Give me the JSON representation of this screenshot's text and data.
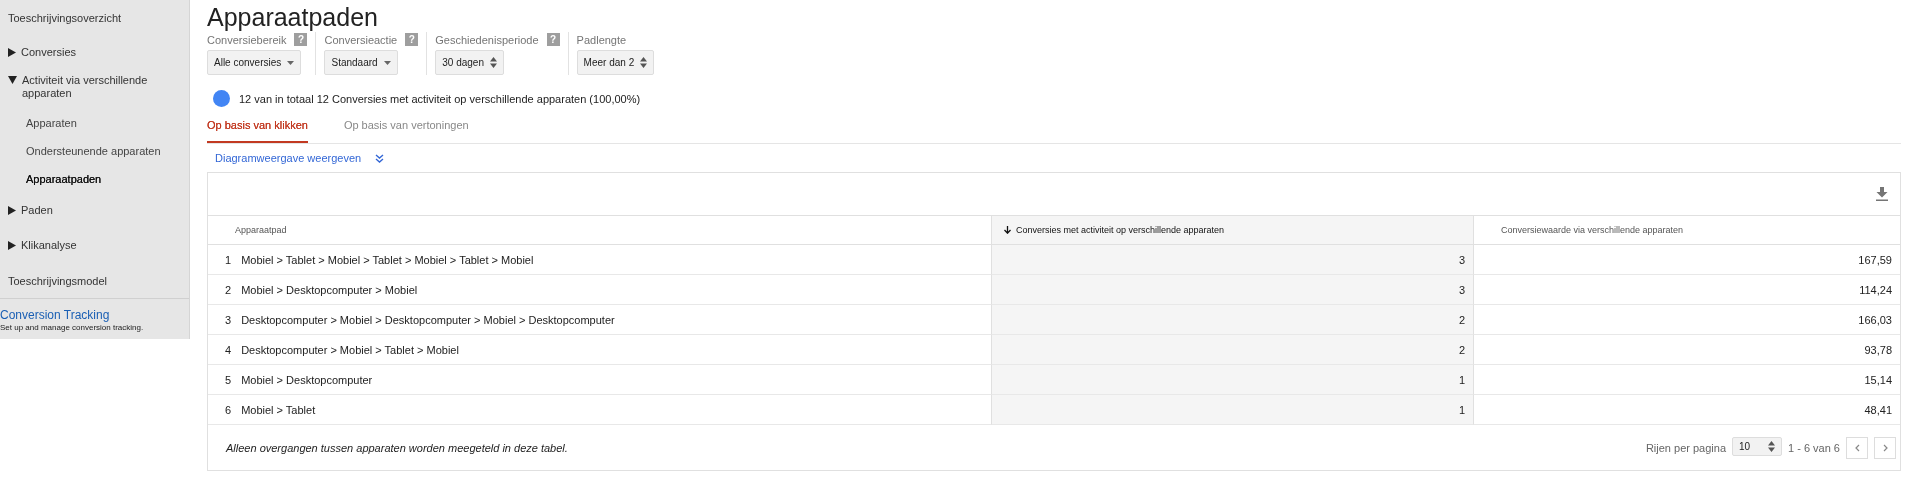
{
  "sidebar": {
    "items": [
      {
        "label": "Toeschrijvingsoverzicht",
        "kind": "link",
        "selected": false
      },
      {
        "label": "Conversies",
        "kind": "group",
        "expanded": false
      },
      {
        "label": "Activiteit via verschillende apparaten",
        "kind": "group",
        "expanded": true,
        "children": [
          {
            "label": "Apparaten",
            "selected": false
          },
          {
            "label": "Ondersteunende apparaten",
            "selected": false
          },
          {
            "label": "Apparaatpaden",
            "selected": true
          }
        ]
      },
      {
        "label": "Paden",
        "kind": "group",
        "expanded": false
      },
      {
        "label": "Klikanalyse",
        "kind": "group",
        "expanded": false
      },
      {
        "label": "Toeschrijvingsmodel",
        "kind": "link",
        "selected": false
      }
    ],
    "promo": {
      "title": "Conversion Tracking",
      "text": "Set up and manage conversion tracking."
    }
  },
  "page": {
    "title": "Apparaatpaden",
    "filters": [
      {
        "label": "Conversiebereik",
        "help": "?",
        "value": "Alle conversies",
        "kind": "dropdown"
      },
      {
        "label": "Conversieactie",
        "help": "?",
        "value": "Standaard",
        "kind": "dropdown"
      },
      {
        "label": "Geschiedenisperiode",
        "help": "?",
        "value": "30 dagen",
        "kind": "spinner"
      },
      {
        "label": "Padlengte",
        "value": "Meer dan 2",
        "kind": "spinner"
      }
    ],
    "summary": "12 van in totaal 12 Conversies met activiteit op verschillende apparaten (100,00%)",
    "tabs": [
      {
        "label": "Op basis van klikken",
        "selected": true
      },
      {
        "label": "Op basis van vertoningen",
        "selected": false
      }
    ],
    "diagram_link": "Diagramweergave weergeven",
    "table": {
      "columns": [
        {
          "label": "Apparaatpad",
          "sorted": false
        },
        {
          "label": "Conversies met activiteit op verschillende apparaten",
          "sorted": true
        },
        {
          "label": "Conversiewaarde via verschillende apparaten",
          "sorted": false
        }
      ],
      "rows": [
        {
          "index": "1",
          "cells": [
            "Mobiel > Tablet > Mobiel > Tablet > Mobiel > Tablet > Mobiel",
            "3",
            "167,59"
          ]
        },
        {
          "index": "2",
          "cells": [
            "Mobiel > Desktopcomputer > Mobiel",
            "3",
            "114,24"
          ]
        },
        {
          "index": "3",
          "cells": [
            "Desktopcomputer > Mobiel > Desktopcomputer > Mobiel > Desktopcomputer",
            "2",
            "166,03"
          ]
        },
        {
          "index": "4",
          "cells": [
            "Desktopcomputer > Mobiel > Tablet > Mobiel",
            "2",
            "93,78"
          ]
        },
        {
          "index": "5",
          "cells": [
            "Mobiel > Desktopcomputer",
            "1",
            "15,14"
          ]
        },
        {
          "index": "6",
          "cells": [
            "Mobiel > Tablet",
            "1",
            "48,41"
          ]
        }
      ],
      "footnote": "Alleen overgangen tussen apparaten worden meegeteld in deze tabel.",
      "rows_per_page_label": "Rijen per pagina",
      "rows_per_page": "10",
      "range": "1 - 6 van 6"
    }
  }
}
